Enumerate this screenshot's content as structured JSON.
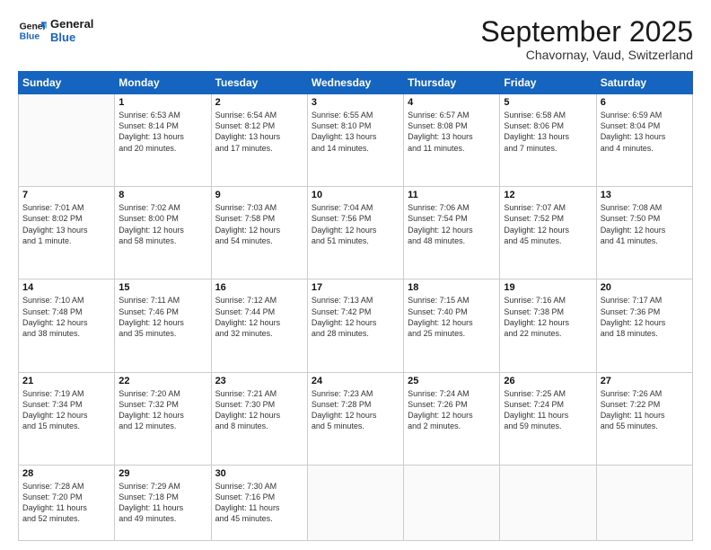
{
  "header": {
    "logo_line1": "General",
    "logo_line2": "Blue",
    "month": "September 2025",
    "location": "Chavornay, Vaud, Switzerland"
  },
  "weekdays": [
    "Sunday",
    "Monday",
    "Tuesday",
    "Wednesday",
    "Thursday",
    "Friday",
    "Saturday"
  ],
  "weeks": [
    [
      {
        "day": "",
        "info": ""
      },
      {
        "day": "1",
        "info": "Sunrise: 6:53 AM\nSunset: 8:14 PM\nDaylight: 13 hours\nand 20 minutes."
      },
      {
        "day": "2",
        "info": "Sunrise: 6:54 AM\nSunset: 8:12 PM\nDaylight: 13 hours\nand 17 minutes."
      },
      {
        "day": "3",
        "info": "Sunrise: 6:55 AM\nSunset: 8:10 PM\nDaylight: 13 hours\nand 14 minutes."
      },
      {
        "day": "4",
        "info": "Sunrise: 6:57 AM\nSunset: 8:08 PM\nDaylight: 13 hours\nand 11 minutes."
      },
      {
        "day": "5",
        "info": "Sunrise: 6:58 AM\nSunset: 8:06 PM\nDaylight: 13 hours\nand 7 minutes."
      },
      {
        "day": "6",
        "info": "Sunrise: 6:59 AM\nSunset: 8:04 PM\nDaylight: 13 hours\nand 4 minutes."
      }
    ],
    [
      {
        "day": "7",
        "info": "Sunrise: 7:01 AM\nSunset: 8:02 PM\nDaylight: 13 hours\nand 1 minute."
      },
      {
        "day": "8",
        "info": "Sunrise: 7:02 AM\nSunset: 8:00 PM\nDaylight: 12 hours\nand 58 minutes."
      },
      {
        "day": "9",
        "info": "Sunrise: 7:03 AM\nSunset: 7:58 PM\nDaylight: 12 hours\nand 54 minutes."
      },
      {
        "day": "10",
        "info": "Sunrise: 7:04 AM\nSunset: 7:56 PM\nDaylight: 12 hours\nand 51 minutes."
      },
      {
        "day": "11",
        "info": "Sunrise: 7:06 AM\nSunset: 7:54 PM\nDaylight: 12 hours\nand 48 minutes."
      },
      {
        "day": "12",
        "info": "Sunrise: 7:07 AM\nSunset: 7:52 PM\nDaylight: 12 hours\nand 45 minutes."
      },
      {
        "day": "13",
        "info": "Sunrise: 7:08 AM\nSunset: 7:50 PM\nDaylight: 12 hours\nand 41 minutes."
      }
    ],
    [
      {
        "day": "14",
        "info": "Sunrise: 7:10 AM\nSunset: 7:48 PM\nDaylight: 12 hours\nand 38 minutes."
      },
      {
        "day": "15",
        "info": "Sunrise: 7:11 AM\nSunset: 7:46 PM\nDaylight: 12 hours\nand 35 minutes."
      },
      {
        "day": "16",
        "info": "Sunrise: 7:12 AM\nSunset: 7:44 PM\nDaylight: 12 hours\nand 32 minutes."
      },
      {
        "day": "17",
        "info": "Sunrise: 7:13 AM\nSunset: 7:42 PM\nDaylight: 12 hours\nand 28 minutes."
      },
      {
        "day": "18",
        "info": "Sunrise: 7:15 AM\nSunset: 7:40 PM\nDaylight: 12 hours\nand 25 minutes."
      },
      {
        "day": "19",
        "info": "Sunrise: 7:16 AM\nSunset: 7:38 PM\nDaylight: 12 hours\nand 22 minutes."
      },
      {
        "day": "20",
        "info": "Sunrise: 7:17 AM\nSunset: 7:36 PM\nDaylight: 12 hours\nand 18 minutes."
      }
    ],
    [
      {
        "day": "21",
        "info": "Sunrise: 7:19 AM\nSunset: 7:34 PM\nDaylight: 12 hours\nand 15 minutes."
      },
      {
        "day": "22",
        "info": "Sunrise: 7:20 AM\nSunset: 7:32 PM\nDaylight: 12 hours\nand 12 minutes."
      },
      {
        "day": "23",
        "info": "Sunrise: 7:21 AM\nSunset: 7:30 PM\nDaylight: 12 hours\nand 8 minutes."
      },
      {
        "day": "24",
        "info": "Sunrise: 7:23 AM\nSunset: 7:28 PM\nDaylight: 12 hours\nand 5 minutes."
      },
      {
        "day": "25",
        "info": "Sunrise: 7:24 AM\nSunset: 7:26 PM\nDaylight: 12 hours\nand 2 minutes."
      },
      {
        "day": "26",
        "info": "Sunrise: 7:25 AM\nSunset: 7:24 PM\nDaylight: 11 hours\nand 59 minutes."
      },
      {
        "day": "27",
        "info": "Sunrise: 7:26 AM\nSunset: 7:22 PM\nDaylight: 11 hours\nand 55 minutes."
      }
    ],
    [
      {
        "day": "28",
        "info": "Sunrise: 7:28 AM\nSunset: 7:20 PM\nDaylight: 11 hours\nand 52 minutes."
      },
      {
        "day": "29",
        "info": "Sunrise: 7:29 AM\nSunset: 7:18 PM\nDaylight: 11 hours\nand 49 minutes."
      },
      {
        "day": "30",
        "info": "Sunrise: 7:30 AM\nSunset: 7:16 PM\nDaylight: 11 hours\nand 45 minutes."
      },
      {
        "day": "",
        "info": ""
      },
      {
        "day": "",
        "info": ""
      },
      {
        "day": "",
        "info": ""
      },
      {
        "day": "",
        "info": ""
      }
    ]
  ]
}
